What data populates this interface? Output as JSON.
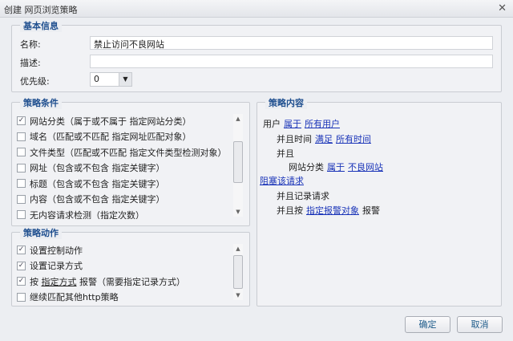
{
  "window": {
    "title": "创建  网页浏览策略",
    "close": "✕"
  },
  "basic": {
    "legend": "基本信息",
    "name_label": "名称:",
    "name_value": "禁止访问不良网站",
    "desc_label": "描述:",
    "desc_value": "",
    "priority_label": "优先级:",
    "priority_value": "0"
  },
  "conditions": {
    "legend": "策略条件",
    "items": [
      {
        "label": "网站分类（属于或不属于  指定网站分类）",
        "checked": true
      },
      {
        "label": "域名（匹配或不匹配  指定网址匹配对象）",
        "checked": false
      },
      {
        "label": "文件类型（匹配或不匹配  指定文件类型检测对象）",
        "checked": false
      },
      {
        "label": "网址（包含或不包含  指定关键字）",
        "checked": false
      },
      {
        "label": "标题（包含或不包含  指定关键字）",
        "checked": false
      },
      {
        "label": "内容（包含或不包含  指定关键字）",
        "checked": false
      },
      {
        "label": "无内容请求检测（指定次数）",
        "checked": false
      }
    ]
  },
  "actions": {
    "legend": "策略动作",
    "items": [
      {
        "label": "设置控制动作",
        "checked": true
      },
      {
        "label": "设置记录方式",
        "checked": true
      },
      {
        "pre": "按",
        "link": "指定方式",
        "post": "报警（需要指定记录方式）",
        "checked": true
      },
      {
        "label": "继续匹配其他http策略",
        "checked": false
      }
    ]
  },
  "content": {
    "legend": "策略内容",
    "l1": {
      "text": "用户",
      "link1": "属于",
      "link2": "所有用户"
    },
    "l2": {
      "text": "并且时间",
      "link1": "满足",
      "link2": "所有时间"
    },
    "l3": {
      "text": "并且"
    },
    "l4": {
      "text": "网站分类",
      "link1": "属于",
      "link2": "不良网站"
    },
    "l5": {
      "link": "阻塞该请求"
    },
    "l6": {
      "text": "并且记录请求"
    },
    "l7": {
      "text": "并且按",
      "link": "指定报警对象",
      "post": "报警"
    }
  },
  "buttons": {
    "ok": "确定",
    "cancel": "取消"
  }
}
